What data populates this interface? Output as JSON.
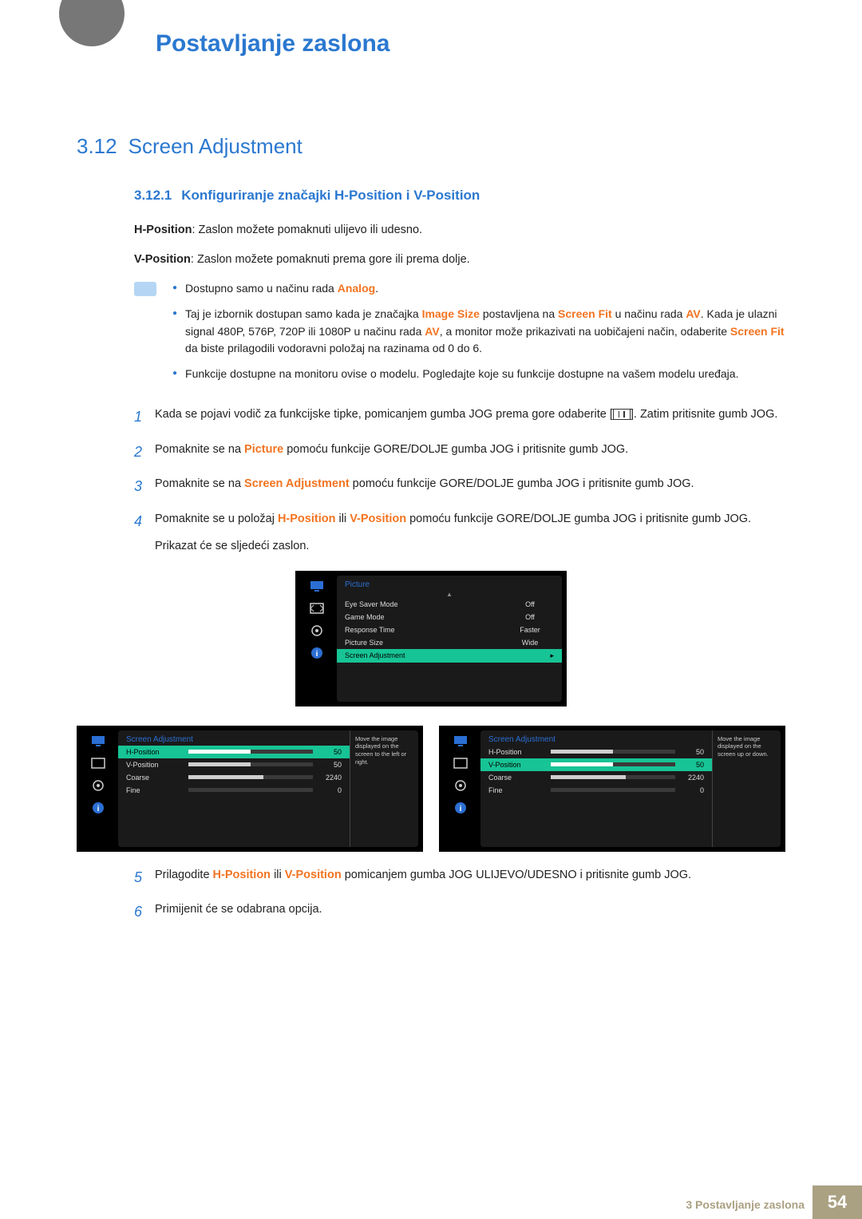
{
  "chapter_title": "Postavljanje zaslona",
  "section_num": "3.12",
  "section_title": "Screen Adjustment",
  "sub_num": "3.12.1",
  "sub_title": "Konfiguriranje značajki H-Position i V-Position",
  "hpos_label": "H-Position",
  "hpos_text": ": Zaslon možete pomaknuti ulijevo ili udesno.",
  "vpos_label": "V-Position",
  "vpos_text": ": Zaslon možete pomaknuti prema gore ili prema dolje.",
  "notes": {
    "n1_a": "Dostupno samo u načinu rada ",
    "n1_b": "Analog",
    "n1_c": ".",
    "n2_a": "Taj je izbornik dostupan samo kada je značajka ",
    "n2_b": "Image Size",
    "n2_c": " postavljena na ",
    "n2_d": "Screen Fit",
    "n2_e": " u načinu rada ",
    "n2_f": "AV",
    "n2_g": ". Kada je ulazni signal 480P, 576P, 720P ili 1080P u načinu rada ",
    "n2_h": "AV",
    "n2_i": ", a monitor može prikazivati na uobičajeni način, odaberite ",
    "n2_j": "Screen Fit",
    "n2_k": " da biste prilagodili vodoravni položaj na razinama od 0 do 6.",
    "n3": "Funkcije dostupne na monitoru ovise o modelu. Pogledajte koje su funkcije dostupne na vašem modelu uređaja."
  },
  "steps": {
    "s1_a": "Kada se pojavi vodič za funkcijske tipke, pomicanjem gumba JOG prema gore odaberite [",
    "s1_b": "]. Zatim pritisnite gumb JOG.",
    "s2_a": "Pomaknite se na ",
    "s2_b": "Picture",
    "s2_c": " pomoću funkcije GORE/DOLJE gumba JOG i pritisnite gumb JOG.",
    "s3_a": "Pomaknite se na ",
    "s3_b": "Screen Adjustment",
    "s3_c": " pomoću funkcije GORE/DOLJE gumba JOG i pritisnite gumb JOG.",
    "s4_a": "Pomaknite se u položaj ",
    "s4_b": "H-Position",
    "s4_c": " ili ",
    "s4_d": "V-Position",
    "s4_e": " pomoću funkcije GORE/DOLJE gumba JOG i pritisnite gumb JOG.",
    "s4_f": "Prikazat će se sljedeći zaslon.",
    "s5_a": "Prilagodite ",
    "s5_b": "H-Position",
    "s5_c": " ili ",
    "s5_d": "V-Position",
    "s5_e": " pomicanjem gumba JOG ULIJEVO/UDESNO i pritisnite gumb JOG.",
    "s6": "Primijenit će se odabrana opcija."
  },
  "osd_main": {
    "title": "Picture",
    "rows": [
      {
        "label": "Eye Saver Mode",
        "val": "Off"
      },
      {
        "label": "Game Mode",
        "val": "Off"
      },
      {
        "label": "Response Time",
        "val": "Faster"
      },
      {
        "label": "Picture Size",
        "val": "Wide"
      }
    ],
    "selected": "Screen Adjustment",
    "selected_arrow": "▸"
  },
  "osd_left": {
    "title": "Screen Adjustment",
    "rows": [
      {
        "label": "H-Position",
        "val": "50",
        "fill": 50,
        "selected": true
      },
      {
        "label": "V-Position",
        "val": "50",
        "fill": 50,
        "selected": false
      },
      {
        "label": "Coarse",
        "val": "2240",
        "fill": 60,
        "selected": false
      },
      {
        "label": "Fine",
        "val": "0",
        "fill": 0,
        "selected": false
      }
    ],
    "info": "Move the image displayed on the screen to the left or right."
  },
  "osd_right": {
    "title": "Screen Adjustment",
    "rows": [
      {
        "label": "H-Position",
        "val": "50",
        "fill": 50,
        "selected": false
      },
      {
        "label": "V-Position",
        "val": "50",
        "fill": 50,
        "selected": true
      },
      {
        "label": "Coarse",
        "val": "2240",
        "fill": 60,
        "selected": false
      },
      {
        "label": "Fine",
        "val": "0",
        "fill": 0,
        "selected": false
      }
    ],
    "info": "Move the image displayed on the screen up or down."
  },
  "footer_text": "3 Postavljanje zaslona",
  "page_num": "54",
  "step_nums": [
    "1",
    "2",
    "3",
    "4",
    "5",
    "6"
  ]
}
